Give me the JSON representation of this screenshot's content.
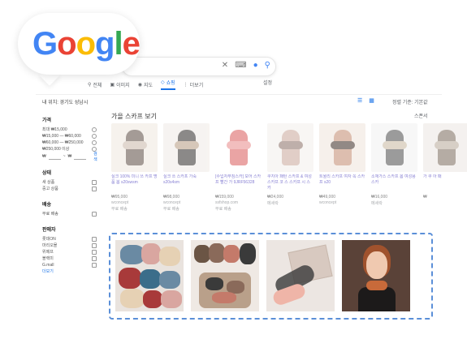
{
  "logo": {
    "letters": [
      "G",
      "o",
      "o",
      "g",
      "l",
      "e"
    ],
    "colors": [
      "#4285F4",
      "#EA4335",
      "#FBBC05",
      "#4285F4",
      "#34A853",
      "#EA4335"
    ]
  },
  "search": {
    "icons": [
      "clear-icon",
      "keyboard-icon",
      "mic-icon",
      "search-icon"
    ]
  },
  "tabs": [
    {
      "label": "전체",
      "icon": "search-icon"
    },
    {
      "label": "이미지",
      "icon": "image-icon"
    },
    {
      "label": "지도",
      "icon": "map-pin-icon"
    },
    {
      "label": "쇼핑",
      "icon": "tag-icon",
      "active": true
    },
    {
      "label": "더보기",
      "icon": "more-icon"
    }
  ],
  "settings_label": "설정",
  "location_text": "내 위치: 경기도 성남시",
  "sort_label": "정렬 기준: 기본값",
  "sidebar": {
    "price": {
      "title": "가격",
      "options": [
        "최대 ₩15,000",
        "₩15,000 — ₩60,000",
        "₩60,000 — ₩250,000",
        "₩250,000 이상"
      ],
      "range_sep": "~",
      "min_symbol": "₩",
      "max_symbol": "₩",
      "go": "검색"
    },
    "condition": {
      "title": "상태",
      "options": [
        "새 상품",
        "중고 상품"
      ]
    },
    "delivery": {
      "title": "배송",
      "options": [
        "무료 배송"
      ]
    },
    "sellers": {
      "title": "판매자",
      "options": [
        "롯데ON",
        "마리오몰",
        "위메프",
        "블랙미",
        "G.mall"
      ],
      "more": "더보기"
    }
  },
  "carousel": {
    "title": "가을 스카프 보기",
    "more_label": "스폰서",
    "products": [
      {
        "name": "실크 100% 미니 쓰 카프 명품 봄 s20swsm",
        "price": "₩95,000",
        "shop": "wconcept",
        "delivery": "무료 배송",
        "colors": [
          "#efe8e0",
          "#5a4a42",
          "#c9b8a8"
        ]
      },
      {
        "name": "실크 쓰 스카프 가죽 s20s4sm",
        "price": "₩98,000",
        "shop": "wconcept",
        "delivery": "무료 배송",
        "colors": [
          "#f0ebe6",
          "#2e2a28",
          "#b59b80"
        ]
      },
      {
        "name": "[수입자무침스카] 모어 스카프 빨간 가 9JRF56328",
        "price": "₩159,000",
        "shop": "ssfshop.com",
        "delivery": "무료 배송",
        "colors": [
          "#ffffff",
          "#d95a5a",
          "#e88a8a"
        ]
      },
      {
        "name": "쿠지아 패턴 스카프 & 여성 스카프 코 스 스카프 시 스카",
        "price": "₩24,000",
        "shop": "메세락",
        "delivery": "",
        "colors": [
          "#f3efec",
          "#c9a79a",
          "#8a6f66"
        ]
      },
      {
        "name": "트윌리 스카프 여자 쪽 스카프 s20",
        "price": "₩49,000",
        "shop": "wconcept",
        "delivery": "",
        "colors": [
          "#f0e5dc",
          "#c28a6f",
          "#3a2a22"
        ]
      },
      {
        "name": "소재가스 스카프 봄 여성용 스카",
        "price": "₩16,000",
        "shop": "메세락",
        "delivery": "",
        "colors": [
          "#f1f1f1",
          "#4a4a4a",
          "#c8b8a0"
        ]
      },
      {
        "name": "가 쿠 아 패",
        "price": "₩",
        "shop": "",
        "delivery": "",
        "colors": [
          "#ece7e2",
          "#7a6a5a",
          "#b8a898"
        ]
      }
    ]
  },
  "highlight": {
    "images": [
      {
        "alt": "folded silk scarves pile",
        "colors": [
          "#d9a6a0",
          "#6a8aa3",
          "#e6d1b4",
          "#a83a3a",
          "#3b6d8a"
        ]
      },
      {
        "alt": "scarves on hanger and table",
        "colors": [
          "#6b5545",
          "#8a6a5a",
          "#b9a08a",
          "#3a3a3a",
          "#c47a6a"
        ]
      },
      {
        "alt": "scarf in gift box",
        "colors": [
          "#ece6e2",
          "#d8c9c0",
          "#7a6a5a",
          "#efb5a8",
          "#3a3a3a"
        ]
      },
      {
        "alt": "woman wearing neck scarf",
        "colors": [
          "#5a4238",
          "#f0c9b0",
          "#1c1a1a",
          "#c86a3a",
          "#a0522d"
        ]
      }
    ]
  }
}
